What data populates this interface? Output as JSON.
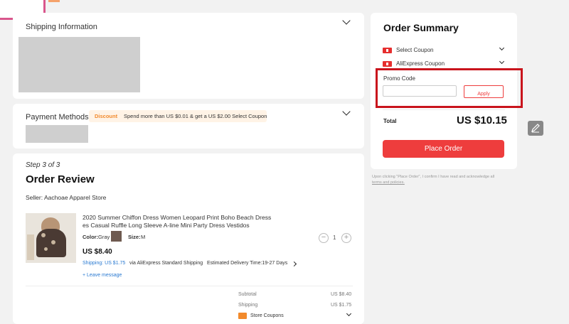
{
  "shipping": {
    "title": "Shipping Information"
  },
  "payment": {
    "title": "Payment Methods",
    "discount_tag": "Discount",
    "discount_text": "Spend more than US $0.01 & get a US $2.00 Select Coupon"
  },
  "review": {
    "step": "Step 3 of 3",
    "title": "Order Review",
    "seller": "Seller: Aachoae Apparel Store",
    "product": {
      "title_line1": "2020 Summer Chiffon Dress Women Leopard Print Boho Beach Dress",
      "title_line2": "es Casual Ruffle Long Sleeve A-line Mini Party Dress Vestidos",
      "color_label": "Color:",
      "color_value": "Gray",
      "size_label": "Size:",
      "size_value": "M",
      "price": "US $8.40",
      "qty": "1",
      "qty_minus": "−",
      "qty_plus": "+",
      "shipping_prefix": "Shipping: US $1.75",
      "shipping_via": "via AliExpress Standard Shipping",
      "delivery": "Estimated Delivery Time:19-27 Days",
      "leave_message": "+ Leave message"
    },
    "subtotal_label": "Subtotal",
    "subtotal_value": "US $8.40",
    "shipping_label": "Shipping",
    "shipping_value": "US $1.75",
    "store_coupons": "Store Coupons"
  },
  "summary": {
    "title": "Order Summary",
    "select_coupon": "Select Coupon",
    "aliexpress_coupon": "AliExpress Coupon",
    "promo_label": "Promo Code",
    "promo_placeholder": "",
    "apply": "Apply",
    "total_label": "Total",
    "total_value": "US $10.15",
    "place_order": "Place Order",
    "disclaimer": "Upon clicking \"Place Order\", I confirm I have read and acknowledge all",
    "terms": "terms and policies."
  },
  "colors": {
    "accent": "#ee3d3d",
    "highlight": "#c9141c"
  }
}
